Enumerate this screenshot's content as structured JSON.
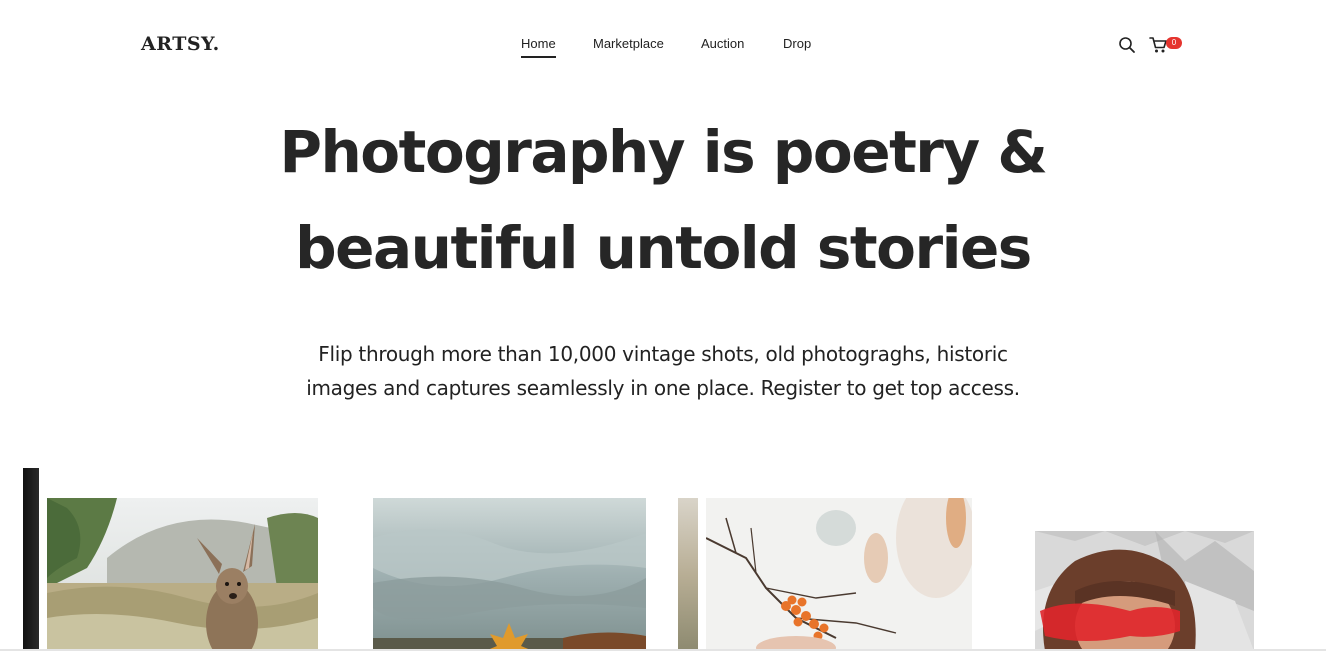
{
  "brand": {
    "logo": "ARTSY."
  },
  "nav": {
    "items": [
      {
        "label": "Home",
        "active": true
      },
      {
        "label": "Marketplace",
        "active": false
      },
      {
        "label": "Auction",
        "active": false
      },
      {
        "label": "Drop",
        "active": false
      }
    ]
  },
  "header": {
    "search_icon": "search-icon",
    "cart_icon": "cart-icon",
    "cart_count": "0",
    "badge_color": "#e5342e"
  },
  "hero": {
    "title_line1": "Photography is poetry &",
    "title_line2": "beautiful untold stories",
    "subtitle_line1": "Flip through more than 10,000 vintage shots, old photograghs, historic",
    "subtitle_line2": "images and captures seamlessly in one place. Register to get top access."
  },
  "gallery": {
    "photos": [
      {
        "subject": "kangaroo"
      },
      {
        "subject": "cloudy-sky"
      },
      {
        "subject": "berry-branch"
      },
      {
        "subject": "person-red-glasses"
      }
    ]
  }
}
